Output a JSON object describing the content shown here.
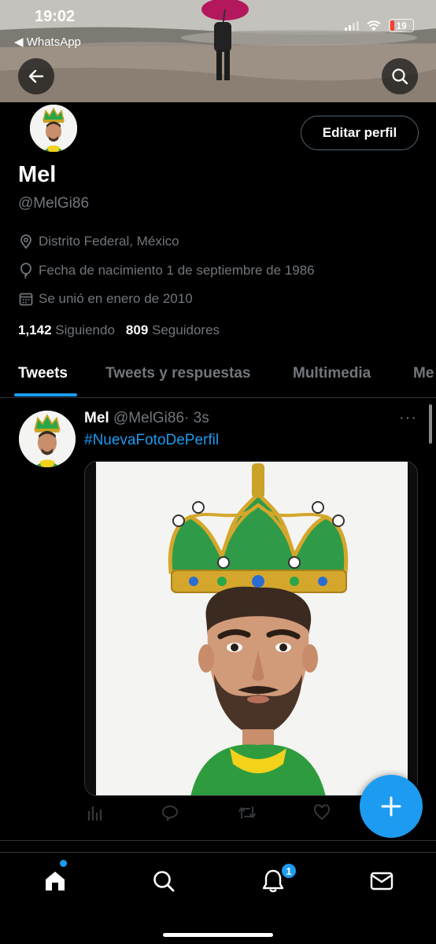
{
  "status_bar": {
    "time": "19:02",
    "back_app": "◀ WhatsApp",
    "battery": "19"
  },
  "profile": {
    "name": "Mel",
    "handle": "@MelGi86",
    "edit_button": "Editar perfil",
    "location": "Distrito Federal, México",
    "birthdate": "Fecha de nacimiento 1 de septiembre de 1986",
    "joined": "Se unió en enero de 2010",
    "following_count": "1,142",
    "following_label": "Siguiendo",
    "followers_count": "809",
    "followers_label": "Seguidores"
  },
  "tabs": [
    {
      "label": "Tweets",
      "active": true
    },
    {
      "label": "Tweets y respuestas",
      "active": false
    },
    {
      "label": "Multimedia",
      "active": false
    },
    {
      "label": "Me",
      "active": false
    }
  ],
  "tweet": {
    "name": "Mel",
    "handle": "@MelGi86",
    "time": "· 3s",
    "text": "#NuevaFotoDePerfil",
    "more": "···"
  },
  "nav": {
    "notifications_badge": "1"
  },
  "colors": {
    "accent": "#1d9bf0",
    "background": "#000000",
    "muted_text": "#71767b",
    "border": "#2f3336"
  },
  "icons": [
    "back-arrow-icon",
    "search-icon",
    "location-pin-icon",
    "birthday-balloon-icon",
    "calendar-icon",
    "more-dots-icon",
    "analytics-icon",
    "reply-icon",
    "retweet-icon",
    "like-icon",
    "compose-plus-icon",
    "home-icon",
    "notifications-bell-icon",
    "messages-envelope-icon"
  ]
}
